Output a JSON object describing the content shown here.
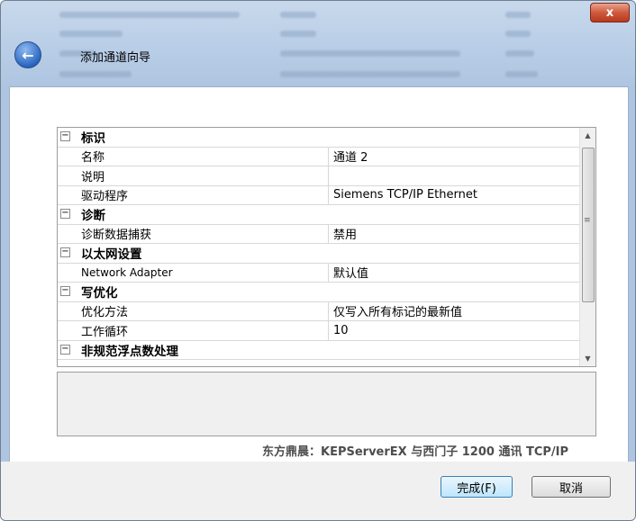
{
  "window": {
    "title": "添加通道向导",
    "close_label": "x",
    "back_label": "←"
  },
  "property_grid": {
    "rows": [
      {
        "type": "category",
        "label": "标识",
        "toggle": "−"
      },
      {
        "type": "property",
        "name": "名称",
        "value": "通道 2"
      },
      {
        "type": "property",
        "name": "说明",
        "value": ""
      },
      {
        "type": "property",
        "name": "驱动程序",
        "value": "Siemens TCP/IP Ethernet"
      },
      {
        "type": "category",
        "label": "诊断",
        "toggle": "−"
      },
      {
        "type": "property",
        "name": "诊断数据捕获",
        "value": "禁用"
      },
      {
        "type": "category",
        "label": "以太网设置",
        "toggle": "−"
      },
      {
        "type": "property",
        "name": "Network Adapter",
        "value": "默认值"
      },
      {
        "type": "category",
        "label": "写优化",
        "toggle": "−"
      },
      {
        "type": "property",
        "name": "优化方法",
        "value": "仅写入所有标记的最新值"
      },
      {
        "type": "property",
        "name": "工作循环",
        "value": "10"
      },
      {
        "type": "category",
        "label": "非规范浮点数处理",
        "toggle": "−"
      }
    ],
    "scroll_up": "▲",
    "scroll_down": "▼",
    "scroll_grip": "≡"
  },
  "watermark": "东方鼎晨：KEPServerEX 与西门子 1200 通讯 TCP/IP",
  "footer": {
    "finish_label": "完成(F)",
    "cancel_label": "取消"
  }
}
